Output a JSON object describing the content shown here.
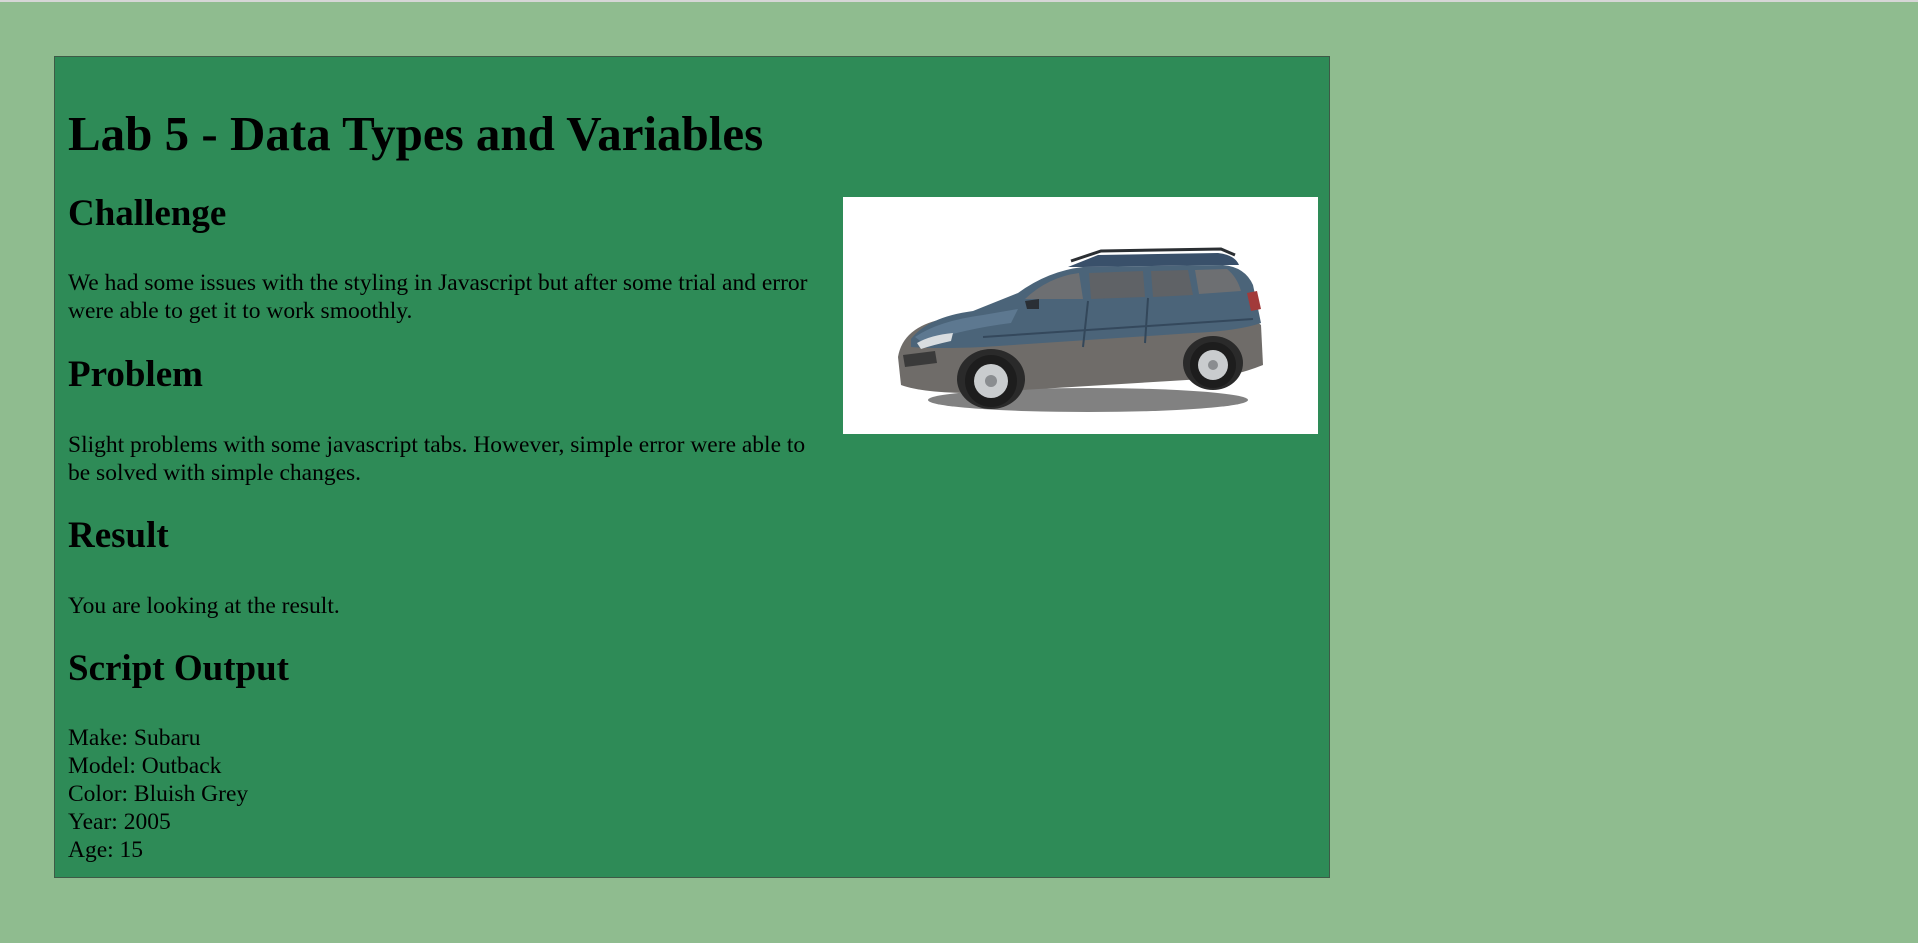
{
  "page": {
    "title": "Lab 5 - Data Types and Variables",
    "sections": {
      "challenge": {
        "heading": "Challenge",
        "text": "We had some issues with the styling in Javascript but after some trial and error were able to get it to work smoothly."
      },
      "problem": {
        "heading": "Problem",
        "text": "Slight problems with some javascript tabs. However, simple error were able to be solved with simple changes."
      },
      "result": {
        "heading": "Result",
        "text": "You are looking at the result."
      },
      "script_output": {
        "heading": "Script Output",
        "lines": [
          "Make: Subaru",
          "Model: Outback",
          "Color: Bluish Grey",
          "Year: 2005",
          "Age: 15"
        ]
      }
    },
    "image": {
      "subject": "car-photo",
      "car_body_color": "#4b6479",
      "car_cladding_color": "#6f6c69"
    }
  },
  "colors": {
    "page_background": "#8fbc8f",
    "panel_background": "#2e8b57"
  }
}
